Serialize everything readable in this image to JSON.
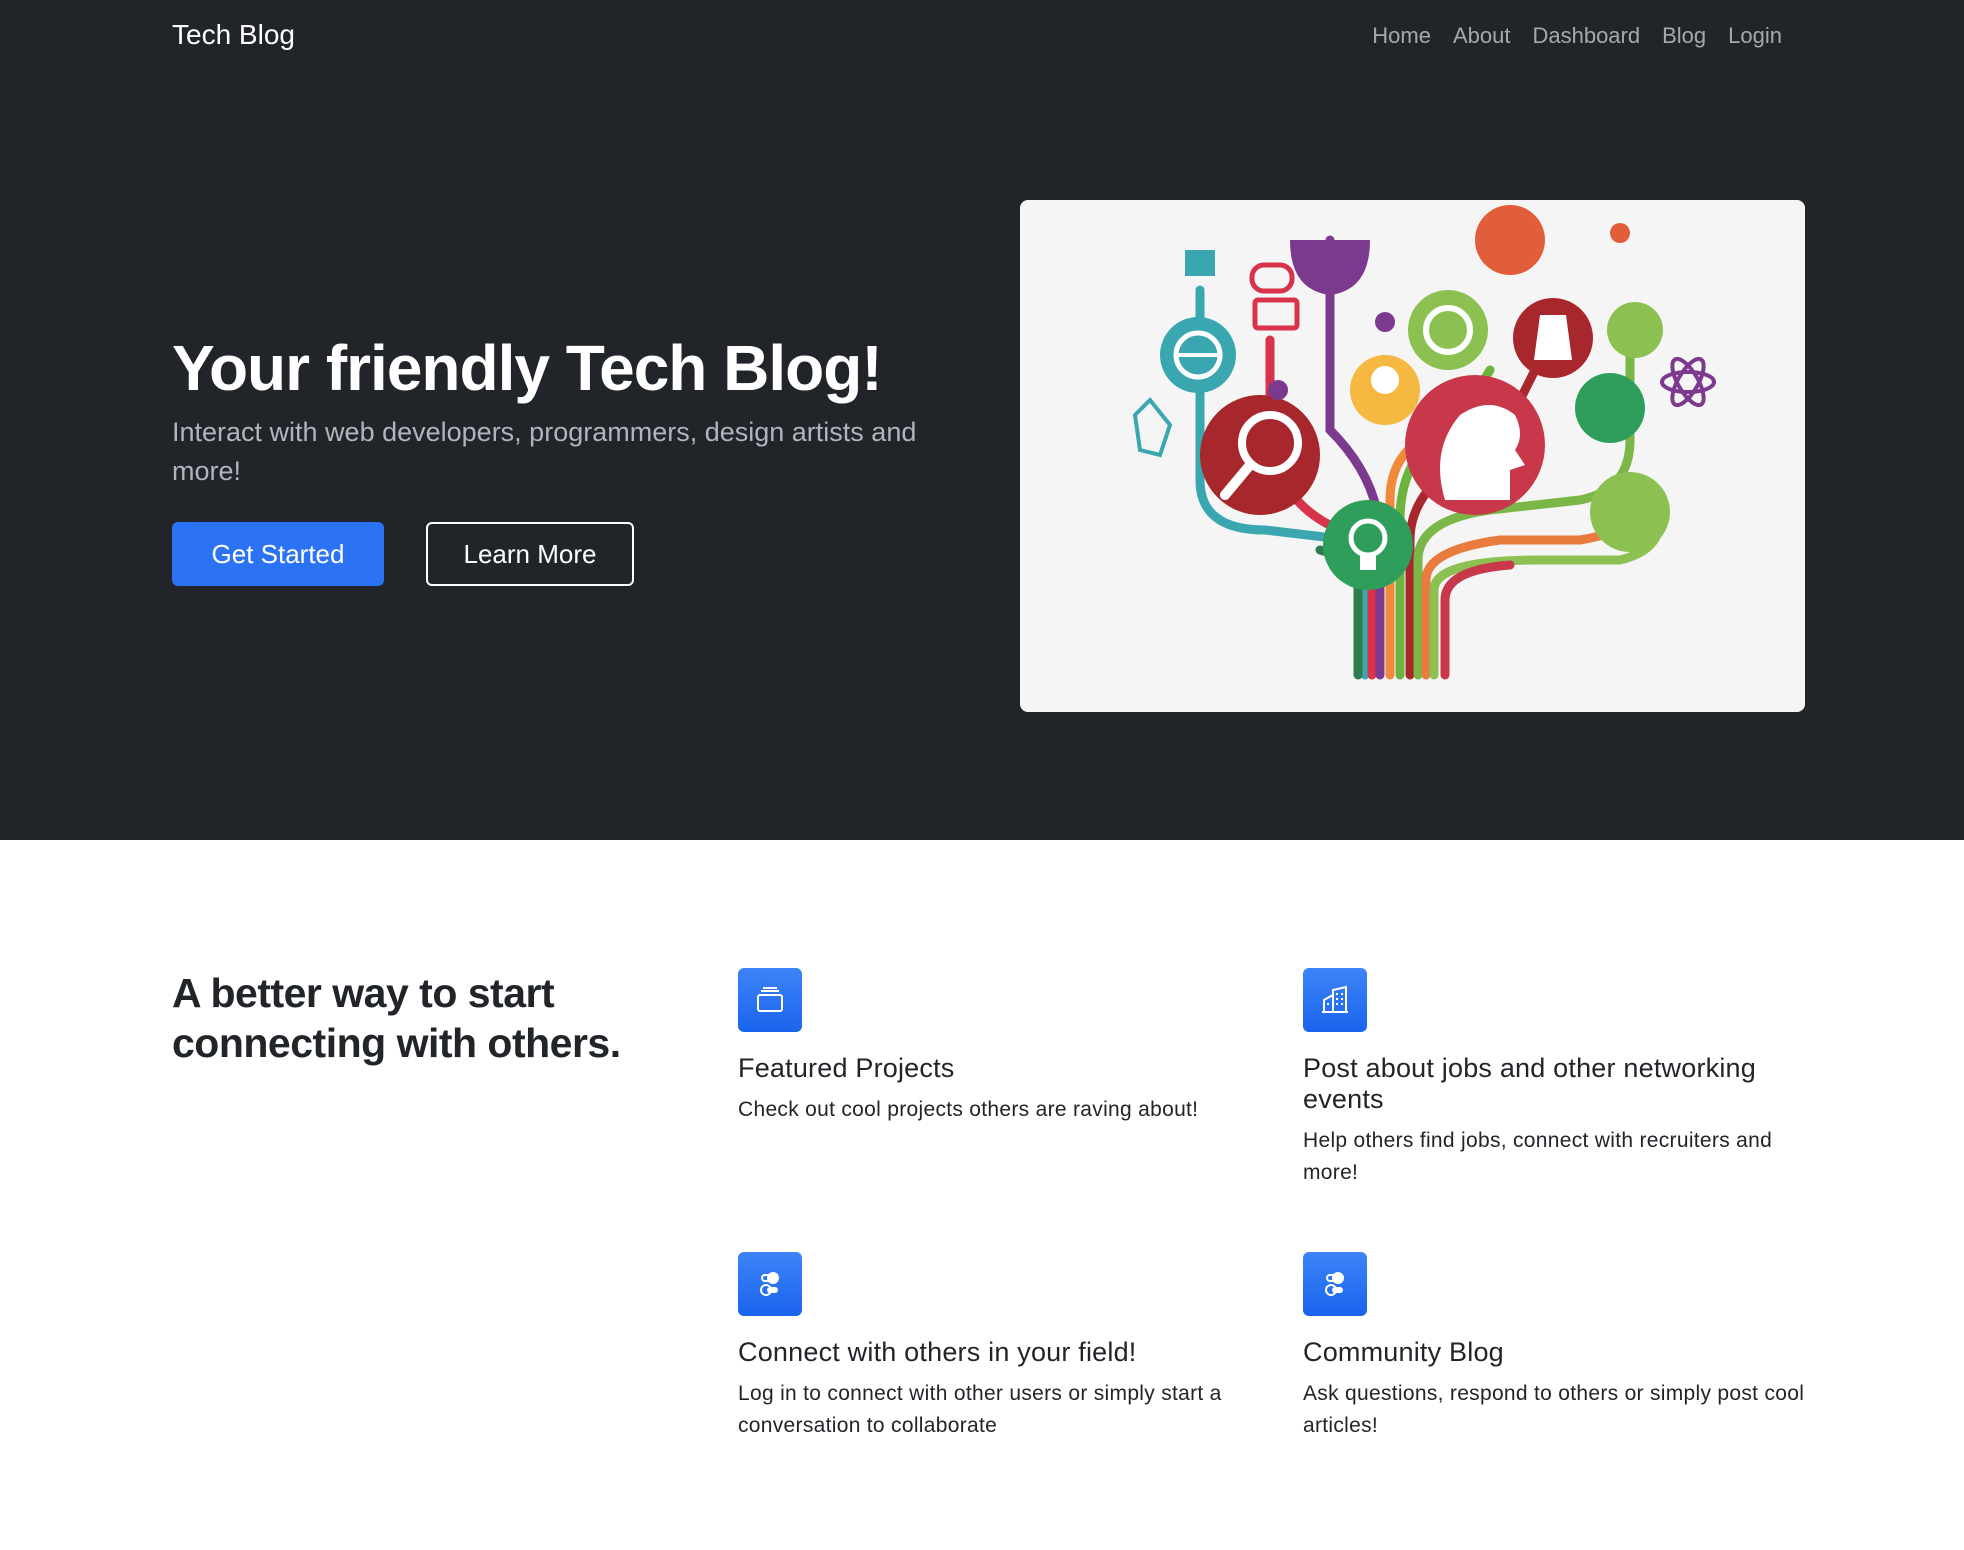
{
  "navbar": {
    "brand": "Tech Blog",
    "links": [
      {
        "label": "Home"
      },
      {
        "label": "About"
      },
      {
        "label": "Dashboard"
      },
      {
        "label": "Blog"
      },
      {
        "label": "Login"
      }
    ]
  },
  "hero": {
    "title": "Your friendly Tech Blog!",
    "lead": "Interact with web developers, programmers, design artists and more!",
    "primary_button": "Get Started",
    "secondary_button": "Learn More"
  },
  "features": {
    "heading": "A better way to start connecting with others.",
    "items": [
      {
        "icon": "collection-icon",
        "title": "Featured Projects",
        "text": "Check out cool projects others are raving about!"
      },
      {
        "icon": "building-icon",
        "title": "Post about jobs and other networking events",
        "text": "Help others find jobs, connect with recruiters and more!"
      },
      {
        "icon": "toggles-icon",
        "title": "Connect with others in your field!",
        "text": "Log in to connect with other users or simply start a conversation to collaborate"
      },
      {
        "icon": "toggles-icon",
        "title": "Community Blog",
        "text": "Ask questions, respond to others or simply post cool articles!"
      }
    ]
  },
  "colors": {
    "dark_bg": "#212529",
    "primary": "#2b72f5",
    "muted_text": "#adb5bd"
  }
}
